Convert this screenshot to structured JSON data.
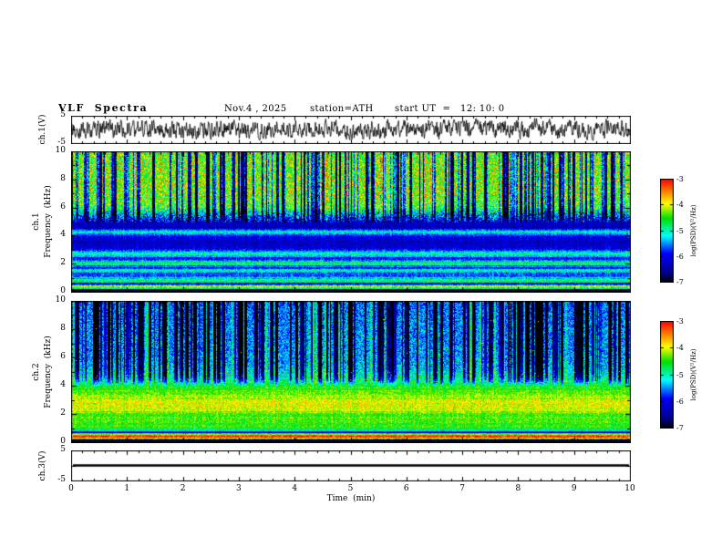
{
  "header": {
    "title": "VLF  Spectra",
    "date": "Nov.4 , 2025",
    "station": "station=ATH",
    "start_ut": "start UT  =   12: 10: 0"
  },
  "xaxis": {
    "label": "Time  (min)",
    "min": 0,
    "max": 10,
    "ticks": [
      0,
      1,
      2,
      3,
      4,
      5,
      6,
      7,
      8,
      9,
      10
    ],
    "minor_step": 0.2
  },
  "panels": {
    "ch1_wave": {
      "ylabel": "ch.1(V)",
      "ymin": -5,
      "ymax": 5,
      "ytick_labels": [
        5,
        -5
      ]
    },
    "ch1_spec": {
      "ylabel_channel": "ch.1",
      "ylabel_axis": "Frequency  (kHz)",
      "ymin": 0,
      "ymax": 10,
      "yticks": [
        0,
        2,
        4,
        6,
        8,
        10
      ]
    },
    "ch2_spec": {
      "ylabel_channel": "ch.2",
      "ylabel_axis": "Frequency  (kHz)",
      "ymin": 0,
      "ymax": 10,
      "yticks": [
        0,
        2,
        4,
        6,
        8,
        10
      ]
    },
    "ch3_wave": {
      "ylabel": "ch.3(V)",
      "ymin": -5,
      "ymax": 5,
      "ytick_labels": [
        5,
        -5
      ]
    }
  },
  "colorbar": {
    "label": "log(PSD)(V²/Hz)",
    "ticks": [
      -3,
      -4,
      -5,
      -6,
      -7
    ],
    "vmin": -7,
    "vmax": -3,
    "colormap_stops": [
      [
        0.0,
        "#000000"
      ],
      [
        0.09,
        "#00008b"
      ],
      [
        0.28,
        "#0000ff"
      ],
      [
        0.45,
        "#00ffff"
      ],
      [
        0.62,
        "#00e000"
      ],
      [
        0.76,
        "#ffff00"
      ],
      [
        0.88,
        "#ff8000"
      ],
      [
        1.0,
        "#ff0000"
      ]
    ]
  },
  "chart_data": [
    {
      "type": "line",
      "name": "ch1_waveform",
      "ylabel": "ch.1(V)",
      "xlim": [
        0,
        10
      ],
      "ylim": [
        -5,
        5
      ],
      "description": "continuous broadband noise waveform, mean 0 V, typical excursions ±2–3 V with frequent spikes reaching ±4.5 V across the full 10 minutes",
      "gen": {
        "seed": 21,
        "points": 1300,
        "persistence": 0.45,
        "step": 5.5,
        "clamp": 4.6
      }
    },
    {
      "type": "heatmap",
      "name": "ch1_spectrogram",
      "ylabel": "ch.1 Frequency (kHz)",
      "xlabel": "Time (min)",
      "x_range": [
        0,
        10
      ],
      "y_range": [
        0,
        10
      ],
      "value_label": "log(PSD)(V²/Hz)",
      "value_range": [
        -7,
        -3
      ],
      "description": "black below 0.25 kHz; bright yellow-green line near 0.4 kHz; dark gap ~0.6 kHz; striped green/blue bands 0.8–3 kHz; blue/dark-blue 3–5.5 kHz with a green line near 4.3 kHz; green-yellow noisy field 5.5–10 kHz with red flecks and many narrow black vertical dropout streaks",
      "profile": [
        [
          0,
          -7
        ],
        [
          0.22,
          -7
        ],
        [
          0.3,
          -4.6
        ],
        [
          0.38,
          -4.0
        ],
        [
          0.5,
          -4.3
        ],
        [
          0.6,
          -6.5
        ],
        [
          0.75,
          -4.7
        ],
        [
          0.95,
          -5.0
        ],
        [
          1.15,
          -5.6
        ],
        [
          1.35,
          -5.9
        ],
        [
          1.55,
          -4.9
        ],
        [
          1.8,
          -5.9
        ],
        [
          2.1,
          -4.7
        ],
        [
          2.4,
          -6.0
        ],
        [
          2.75,
          -4.9
        ],
        [
          3.1,
          -6.1
        ],
        [
          3.6,
          -6.3
        ],
        [
          4.0,
          -6.0
        ],
        [
          4.3,
          -5.0
        ],
        [
          4.6,
          -6.4
        ],
        [
          5.0,
          -6.2
        ],
        [
          5.5,
          -5.4
        ],
        [
          6.0,
          -4.6
        ],
        [
          6.6,
          -4.35
        ],
        [
          7.5,
          -4.25
        ],
        [
          8.5,
          -4.25
        ],
        [
          9.4,
          -4.3
        ],
        [
          10,
          -4.4
        ]
      ],
      "gen": {
        "seed": 7,
        "noise": [
          {
            "f_lo": 0,
            "f_hi": 5.0,
            "amp": 0.35
          },
          {
            "f_lo": 5.0,
            "f_hi": 10,
            "amp": 0.8
          }
        ],
        "stripe_fmax": 2.6,
        "stripe_amp": 0.55,
        "dark_streaks": {
          "count": 170,
          "f_min": 4.9,
          "max_depth": 2.8
        },
        "bright_streaks": {
          "count": 45,
          "f_min": 5.2,
          "max_boost": 0.55
        },
        "speckles": [
          {
            "f_lo": 5.5,
            "f_hi": 10,
            "density": 0.005,
            "value": -3.1
          }
        ]
      }
    },
    {
      "type": "heatmap",
      "name": "ch2_spectrogram",
      "ylabel": "ch.2 Frequency (kHz)",
      "xlabel": "Time (min)",
      "x_range": [
        0,
        10
      ],
      "y_range": [
        0,
        10
      ],
      "value_label": "log(PSD)(V²/Hz)",
      "value_range": [
        -7,
        -3
      ],
      "description": "black below 0.25 kHz; intense red band 0.35–0.6 kHz; dark gap ~0.75 kHz; green field 1–4 kHz with yellow band near 2.5–3.2 kHz and dark-red speckled rows near 4.3–5 kHz; cyan/blue field 5–10 kHz crossed by many dark-blue and black vertical streaks",
      "profile": [
        [
          0,
          -7
        ],
        [
          0.25,
          -6.9
        ],
        [
          0.33,
          -4.0
        ],
        [
          0.4,
          -3.15
        ],
        [
          0.55,
          -3.3
        ],
        [
          0.65,
          -5.0
        ],
        [
          0.75,
          -6.6
        ],
        [
          0.9,
          -4.8
        ],
        [
          1.1,
          -4.55
        ],
        [
          1.5,
          -4.5
        ],
        [
          1.9,
          -4.35
        ],
        [
          2.3,
          -4.15
        ],
        [
          2.7,
          -4.0
        ],
        [
          3.1,
          -4.1
        ],
        [
          3.5,
          -4.3
        ],
        [
          3.9,
          -4.5
        ],
        [
          4.3,
          -4.75
        ],
        [
          4.7,
          -5.0
        ],
        [
          5.2,
          -5.3
        ],
        [
          6.0,
          -5.45
        ],
        [
          7.0,
          -5.5
        ],
        [
          8.0,
          -5.55
        ],
        [
          9.0,
          -5.6
        ],
        [
          10,
          -5.65
        ]
      ],
      "gen": {
        "seed": 13,
        "noise": [
          {
            "f_lo": 0,
            "f_hi": 4.2,
            "amp": 0.3
          },
          {
            "f_lo": 4.2,
            "f_hi": 10,
            "amp": 0.55
          }
        ],
        "stripe_fmax": 4.0,
        "stripe_amp": 0.3,
        "dark_streaks": {
          "count": 200,
          "f_min": 3.9,
          "max_depth": 2.3
        },
        "bright_streaks": {
          "count": 80,
          "f_min": 4.0,
          "max_boost": 0.8
        },
        "speckles": [
          {
            "f_lo": 4.2,
            "f_hi": 5.0,
            "density": 0.02,
            "value": -3.6
          },
          {
            "f_lo": 5.0,
            "f_hi": 10,
            "density": 0.001,
            "value": -3.8
          }
        ]
      }
    },
    {
      "type": "line",
      "name": "ch3_waveform",
      "ylabel": "ch.3(V)",
      "xlim": [
        0,
        10
      ],
      "ylim": [
        -5,
        5
      ],
      "value": 0,
      "description": "constant flat line at 0 V for the entire record"
    }
  ]
}
